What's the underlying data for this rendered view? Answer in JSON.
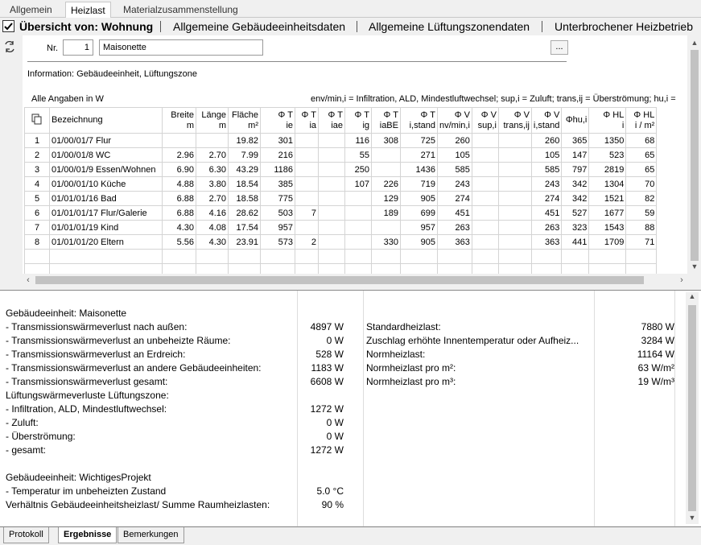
{
  "tabs": [
    "Allgemein",
    "Heizlast",
    "Materialzusammenstellung"
  ],
  "header": {
    "title": "Übersicht von: Wohnung",
    "links": [
      "Allgemeine Gebäudeeinheitsdaten",
      "Allgemeine Lüftungszonendaten",
      "Unterbrochener Heizbetrieb"
    ]
  },
  "form": {
    "nr_label": "Nr.",
    "nr_value": "1",
    "name_value": "Maisonette",
    "dots": "...",
    "info": "Information: Gebäudeeinheit, Lüftungszone",
    "units_note": "Alle Angaben in W",
    "legend": "env/min,i = Infiltration, ALD, Mindestluftwechsel; sup,i = Zuluft; trans,ij = Überströmung; hu,i ="
  },
  "table": {
    "headers": [
      [
        "",
        ""
      ],
      [
        "Bezeichnung",
        ""
      ],
      [
        "Breite",
        "m"
      ],
      [
        "Länge",
        "m"
      ],
      [
        "Fläche",
        "m²"
      ],
      [
        "Φ T",
        "ie"
      ],
      [
        "Φ T",
        "ia"
      ],
      [
        "Φ T",
        "iae"
      ],
      [
        "Φ T",
        "ig"
      ],
      [
        "Φ T",
        "iaBE"
      ],
      [
        "Φ T",
        "i,stand"
      ],
      [
        "Φ V",
        "nv/min,i"
      ],
      [
        "Φ V",
        "sup,i"
      ],
      [
        "Φ V",
        "trans,ij"
      ],
      [
        "Φ V",
        "i,stand"
      ],
      [
        "Φhu,i",
        ""
      ],
      [
        "Φ HL",
        "i"
      ],
      [
        "Φ HL",
        "i / m²"
      ]
    ],
    "rows": [
      [
        "1",
        "01/00/01/7 Flur",
        "",
        "",
        "19.82",
        "301",
        "",
        "",
        "116",
        "308",
        "725",
        "260",
        "",
        "",
        "260",
        "365",
        "1350",
        "68"
      ],
      [
        "2",
        "01/00/01/8 WC",
        "2.96",
        "2.70",
        "7.99",
        "216",
        "",
        "",
        "55",
        "",
        "271",
        "105",
        "",
        "",
        "105",
        "147",
        "523",
        "65"
      ],
      [
        "3",
        "01/00/01/9 Essen/Wohnen",
        "6.90",
        "6.30",
        "43.29",
        "1186",
        "",
        "",
        "250",
        "",
        "1436",
        "585",
        "",
        "",
        "585",
        "797",
        "2819",
        "65"
      ],
      [
        "4",
        "01/00/01/10 Küche",
        "4.88",
        "3.80",
        "18.54",
        "385",
        "",
        "",
        "107",
        "226",
        "719",
        "243",
        "",
        "",
        "243",
        "342",
        "1304",
        "70"
      ],
      [
        "5",
        "01/01/01/16 Bad",
        "6.88",
        "2.70",
        "18.58",
        "775",
        "",
        "",
        "",
        "129",
        "905",
        "274",
        "",
        "",
        "274",
        "342",
        "1521",
        "82"
      ],
      [
        "6",
        "01/01/01/17 Flur/Galerie",
        "6.88",
        "4.16",
        "28.62",
        "503",
        "7",
        "",
        "",
        "189",
        "699",
        "451",
        "",
        "",
        "451",
        "527",
        "1677",
        "59"
      ],
      [
        "7",
        "01/01/01/19 Kind",
        "4.30",
        "4.08",
        "17.54",
        "957",
        "",
        "",
        "",
        "",
        "957",
        "263",
        "",
        "",
        "263",
        "323",
        "1543",
        "88"
      ],
      [
        "8",
        "01/01/01/20 Eltern",
        "5.56",
        "4.30",
        "23.91",
        "573",
        "2",
        "",
        "",
        "330",
        "905",
        "363",
        "",
        "",
        "363",
        "441",
        "1709",
        "71"
      ]
    ]
  },
  "results_left": [
    {
      "label": "Gebäudeeinheit: Maisonette",
      "value": ""
    },
    {
      "label": "- Transmissionswärmeverlust nach außen:",
      "value": "4897 W"
    },
    {
      "label": "- Transmissionswärmeverlust an unbeheizte Räume:",
      "value": "0 W"
    },
    {
      "label": "- Transmissionswärmeverlust an Erdreich:",
      "value": "528 W"
    },
    {
      "label": "- Transmissionswärmeverlust an andere Gebäudeeinheiten:",
      "value": "1183 W"
    },
    {
      "label": "- Transmissionswärmeverlust gesamt:",
      "value": "6608 W"
    },
    {
      "label": "Lüftungswärmeverluste Lüftungszone:",
      "value": ""
    },
    {
      "label": "- Infiltration, ALD, Mindestluftwechsel:",
      "value": "1272 W"
    },
    {
      "label": "- Zuluft:",
      "value": "0 W"
    },
    {
      "label": "- Überströmung:",
      "value": "0 W"
    },
    {
      "label": "- gesamt:",
      "value": "1272 W"
    },
    {
      "label": "",
      "value": ""
    },
    {
      "label": "Gebäudeeinheit: WichtigesProjekt",
      "value": ""
    },
    {
      "label": "- Temperatur im unbeheizten Zustand",
      "value": "5.0 °C"
    },
    {
      "label": "Verhältnis Gebäudeeinheitsheizlast/ Summe Raumheizlasten:",
      "value": "90 %"
    }
  ],
  "results_right": [
    {
      "label": "Standardheizlast:",
      "value": "7880 W"
    },
    {
      "label": "Zuschlag erhöhte Innentemperatur oder Aufheiz...",
      "value": "3284 W"
    },
    {
      "label": "Normheizlast:",
      "value": "11164 W"
    },
    {
      "label": "Normheizlast pro m²:",
      "value": "63 W/m²"
    },
    {
      "label": "Normheizlast pro m³:",
      "value": "19 W/m³"
    }
  ],
  "bottom_tabs": [
    "Protokoll",
    "Ergebnisse",
    "Bemerkungen"
  ]
}
